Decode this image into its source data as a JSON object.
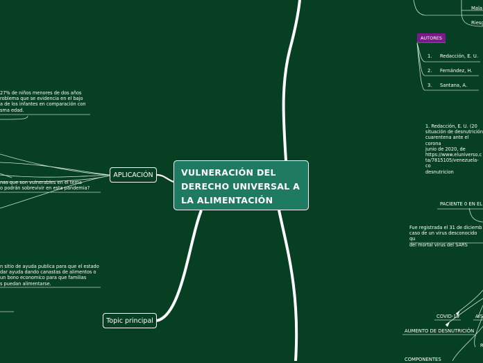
{
  "central_topic": "VULNERACIÓN DEL DERECHO UNIVERSAL A LA ALIMENTACIÓN",
  "topics": {
    "aplicacion": "APLICACIÓN",
    "topic_principal": "Topic principal"
  },
  "left_notes": {
    "ninos": "27% de niños menores de dos años\nroblema que se evidencia en el bajo\na de los infantes en comparación con\nsma edad.",
    "pregunta": "nas que son vulnerables en el tema\no podrán sobrevivir en esta pandemia?",
    "ayuda": "n sitio de ayuda publica para que el estado\ndar ayuda dando canastas de alimentos o\nun bono economico para que familias\ns puedan alimentarse."
  },
  "right_top": {
    "items": [
      "Mala",
      "Riesg"
    ]
  },
  "autores": {
    "label": "AUTORES",
    "items": [
      {
        "num": "1.",
        "name": "Redacción, E. U."
      },
      {
        "num": "2.",
        "name": "Fernández, H."
      },
      {
        "num": "3.",
        "name": "Santana, A."
      }
    ]
  },
  "referencia": "1.      Redacción, E. U. (20\nsituación de desnutrición\ncuarentena ante el corona\njunio de 2020, de\nhttps://www.eluniverso.c\nta/7815105/venezuela-co\ndesnutricion",
  "paciente": {
    "label": "PACIENTE 0 EN EL",
    "text": "Fue registrada el 31 de diciemb\ncaso de un virus desconocido qu\ndel mortal virus del SARS"
  },
  "bottom_right": {
    "covid": "COVID-19",
    "ais": "AIS",
    "aumento": "AUMENTO DE DESNUTRICIÓN",
    "r": "R",
    "componentes": "COMPONENTES"
  }
}
